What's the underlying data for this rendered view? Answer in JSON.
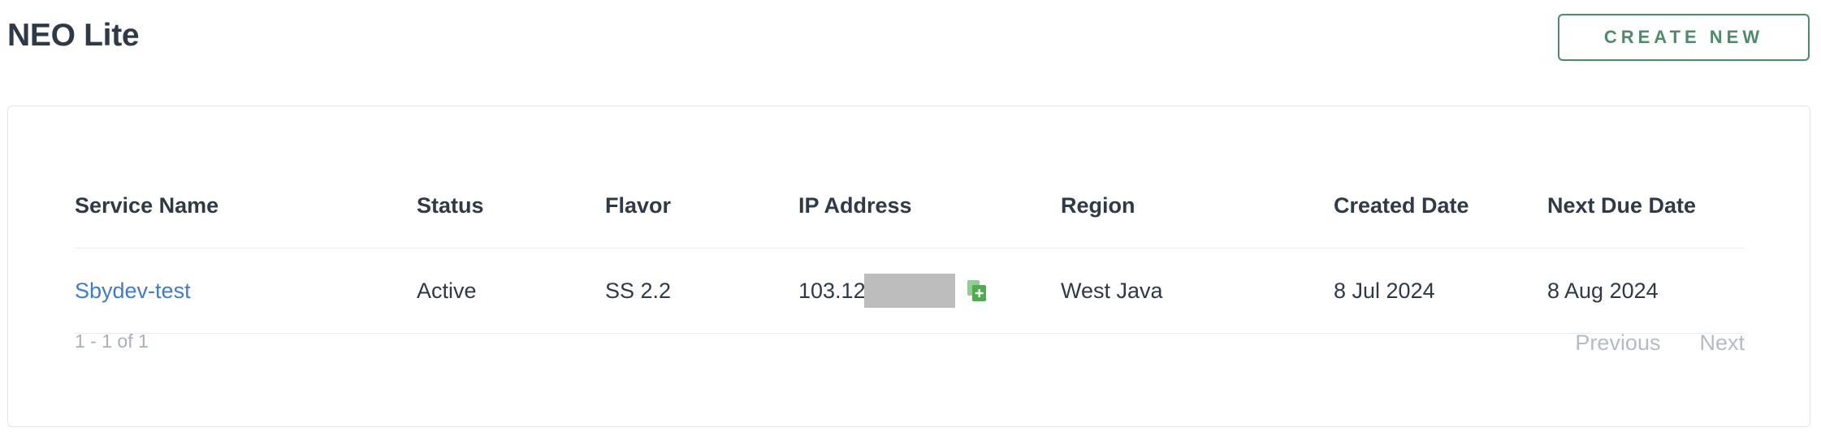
{
  "header": {
    "title": "NEO Lite",
    "create_button_label": "CREATE NEW"
  },
  "table": {
    "columns": [
      "Service Name",
      "Status",
      "Flavor",
      "IP Address",
      "Region",
      "Created Date",
      "Next Due Date"
    ],
    "rows": [
      {
        "service_name": "Sbydev-test",
        "status": "Active",
        "flavor": "SS 2.2",
        "ip_address_visible": "103.12",
        "region": "West Java",
        "created_date": "8 Jul 2024",
        "next_due_date": "8 Aug 2024"
      }
    ]
  },
  "pagination": {
    "range_text": "1 - 1 of 1",
    "previous_label": "Previous",
    "next_label": "Next"
  },
  "colors": {
    "accent_green": "#4e8a6b",
    "link_blue": "#3f7bd1",
    "copy_icon_green": "#5cb85c",
    "muted_gray": "#b4bcc4"
  },
  "icons": {
    "copy": "copy-icon"
  }
}
